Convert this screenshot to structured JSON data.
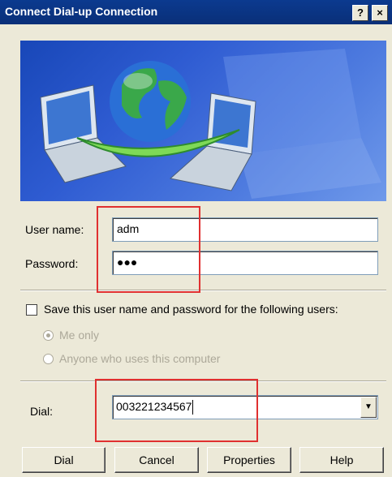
{
  "window": {
    "title": "Connect Dial-up Connection",
    "help_label": "?",
    "close_label": "×"
  },
  "form": {
    "username_label": "User name:",
    "username_value": "adm",
    "password_label": "Password:",
    "password_value": "●●●",
    "save_label": "Save this user name and password for the following users:",
    "save_checked": false,
    "radio_me_label": "Me only",
    "radio_anyone_label": "Anyone who uses this computer",
    "dial_label": "Dial:",
    "dial_value": "003221234567"
  },
  "buttons": {
    "dial": "Dial",
    "cancel": "Cancel",
    "properties": "Properties",
    "help": "Help"
  },
  "colors": {
    "title_bar": "#0a2f78",
    "highlight": "#e03030",
    "dialog_bg": "#ece9d8"
  },
  "icons": {
    "dropdown": "chevron-down-icon",
    "globe": "globe-icon",
    "laptop": "laptop-icon"
  }
}
